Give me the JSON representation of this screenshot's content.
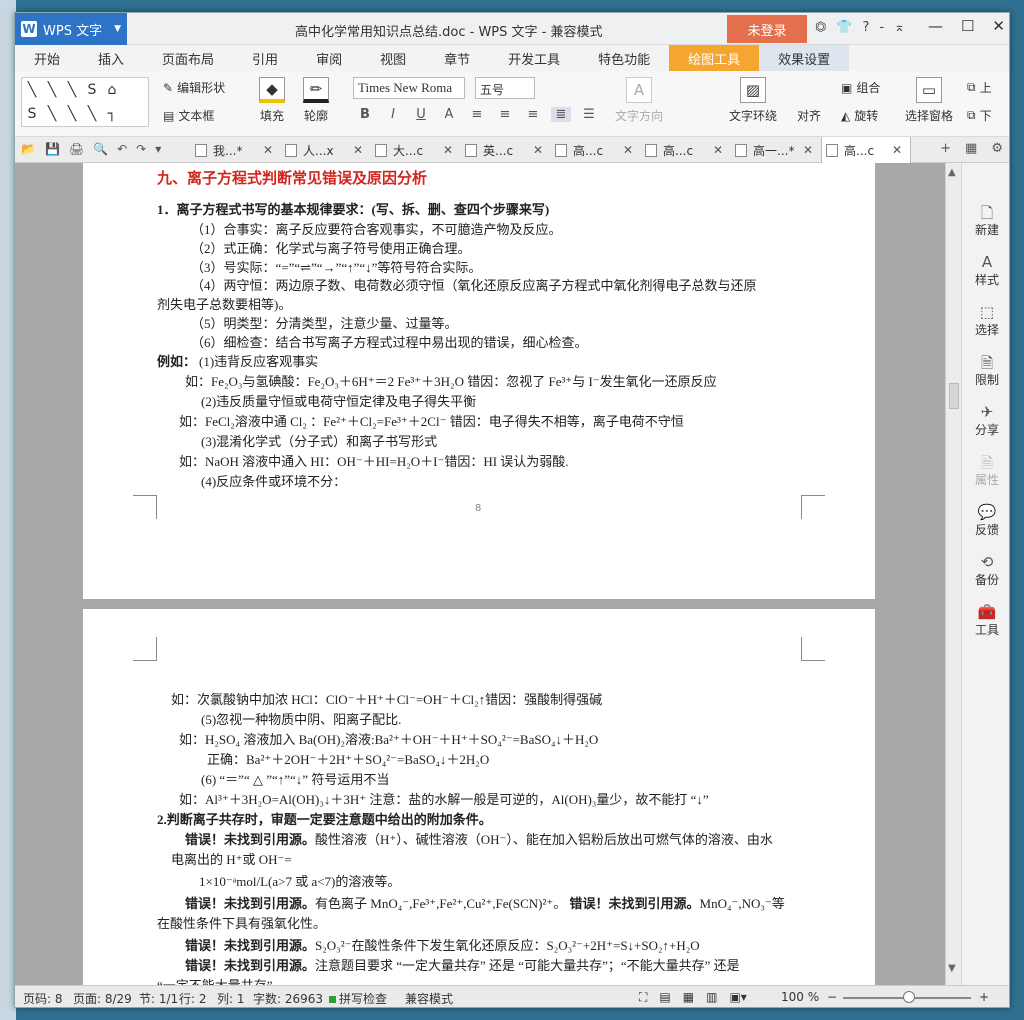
{
  "window": {
    "app_name": "WPS 文字",
    "title": "高中化学常用知识点总结.doc - WPS 文字 - 兼容模式",
    "login": "未登录",
    "title_icons": [
      "⏣",
      "👕",
      "?",
      "-",
      "⌅"
    ],
    "controls": [
      "—",
      "☐",
      "✕"
    ]
  },
  "menu": [
    "开始",
    "插入",
    "页面布局",
    "引用",
    "审阅",
    "视图",
    "章节",
    "开发工具",
    "特色功能",
    "绘图工具",
    "效果设置"
  ],
  "ribbon": {
    "shapes": [
      "╲",
      "╲",
      "╲",
      "S",
      "⌂",
      "",
      "S",
      "╲",
      "╲",
      "╲",
      "┐",
      ""
    ],
    "edit_shape": "编辑形状",
    "text_box": "文本框",
    "fill": "填充",
    "outline": "轮廓",
    "font": "Times New Roma",
    "size": "五号",
    "format_buttons": [
      "B",
      "I",
      "U",
      "A",
      "≡",
      "≡",
      "≡",
      "≣",
      "☰"
    ],
    "text_direction": "文字方向",
    "text_wrap": "文字环绕",
    "align": "对齐",
    "group": "组合",
    "rotate": "旋转",
    "selection_pane": "选择窗格",
    "up": "上",
    "down": "下"
  },
  "tabs": [
    "我...*",
    "人...x",
    "大...c",
    "英...c",
    "高...c",
    "高...c",
    "高一...*",
    "高...c"
  ],
  "quick_access": [
    "📂",
    "💾",
    "🖨",
    "🔍",
    "↶",
    "↷",
    "▾"
  ],
  "tab_right": [
    "+",
    "▦",
    "⚙"
  ],
  "page1": {
    "heading": "九、离子方程式判断常见错误及原因分析",
    "section1": "1．离子方程式书写的基本规律要求：(写、拆、删、查四个步骤来写)",
    "l1": "（1）合事实：离子反应要符合客观事实，不可臆造产物及反应。",
    "l2": "（2）式正确：化学式与离子符号使用正确合理。",
    "l3": "（3）号实际：“=”“⇌”“→”“↑”“↓”等符号符合实际。",
    "l4a": "（4）两守恒：两边原子数、电荷数必须守恒（氧化还原反应离子方程式中氧化剂得电子总数与还原",
    "l4b": "剂失电子总数要相等)。",
    "l5": "（5）明类型：分清类型，注意少量、过量等。",
    "l6": "（6）细检查：结合书写离子方程式过程中易出现的错误，细心检查。",
    "ex_label": "例如：",
    "ex_1": "(1)违背反应客观事实",
    "ex_1a": "如：Fe₂O₃与氢碘酸：Fe₂O₃＋6H⁺＝2 Fe³⁺＋3H₂O 错因：忽视了 Fe³⁺与 I⁻发生氧化一还原反应",
    "ex_2": "(2)违反质量守恒或电荷守恒定律及电子得失平衡",
    "ex_2a": "如：FeCl₂溶液中通 Cl₂ ：Fe²⁺＋Cl₂=Fe³⁺＋2Cl⁻ 错因：电子得失不相等，离子电荷不守恒",
    "ex_3": "(3)混淆化学式（分子式）和离子书写形式",
    "ex_3a": "如：NaOH 溶液中通入 HI：OH⁻＋HI=H₂O＋I⁻错因：HI 误认为弱酸.",
    "ex_4": "(4)反应条件或环境不分：",
    "page_number": "8"
  },
  "page2": {
    "p1": "如：次氯酸钠中加浓 HCl：ClO⁻＋H⁺＋Cl⁻=OH⁻＋Cl₂↑错因：强酸制得强碱",
    "p2": "(5)忽视一种物质中阴、阳离子配比.",
    "p3": "如：H₂SO₄  溶液加入 Ba(OH)₂溶液:Ba²⁺＋OH⁻＋H⁺＋SO₄²⁻=BaSO₄↓＋H₂O",
    "p4": "正确：Ba²⁺＋2OH⁻＋2H⁺＋SO₄²⁻=BaSO₄↓＋2H₂O",
    "p5": "(6) “＝”“ △ ”“↑”“↓” 符号运用不当",
    "p6": "如：Al³⁺＋3H₂O=Al(OH)₃↓＋3H⁺ 注意：盐的水解一般是可逆的，Al(OH)₃量少，故不能打 “↓”",
    "s2": "2.判断离子共存时，审题一定要注意题中给出的附加条件。",
    "err": "错误！未找到引用源。",
    "e1a": "酸性溶液（H⁺）、碱性溶液（OH⁻）、能在加入铝粉后放出可燃气体的溶液、由水",
    "e1b": "电离出的 H⁺或 OH⁻=",
    "e1c": "1×10⁻ᵃmol/L(a>7 或 a<7)的溶液等。",
    "e2a": "有色离子 MnO₄⁻,Fe³⁺,Fe²⁺,Cu²⁺,Fe(SCN)²⁺。",
    "e2b": "MnO₄⁻,NO₃⁻等",
    "e2c": "在酸性条件下具有强氧化性。",
    "e3": "S₂O₃²⁻在酸性条件下发生氧化还原反应：S₂O₃²⁻+2H⁺=S↓+SO₂↑+H₂O",
    "e4": "注意题目要求 “一定大量共存” 还是 “可能大量共存”；“不能大量共存” 还是",
    "e5": "“一定不能大量共存”"
  },
  "side_panel": [
    "新建",
    "样式",
    "选择",
    "限制",
    "分享",
    "属性",
    "反馈",
    "备份",
    "工具"
  ],
  "side_icons": [
    "🗋",
    "A",
    "⬚",
    "🗎",
    "✈",
    "🗎",
    "💬",
    "⟲",
    "🧰"
  ],
  "status": {
    "page": "页码: 8",
    "pages": "页面: 8/29",
    "section": "节: 1/1",
    "row": "行: 2",
    "col": "列: 1",
    "words": "字数: 26963",
    "spell": "拼写检查",
    "mode": "兼容模式",
    "zoom": "100 %",
    "zoom_level": 0.47
  }
}
